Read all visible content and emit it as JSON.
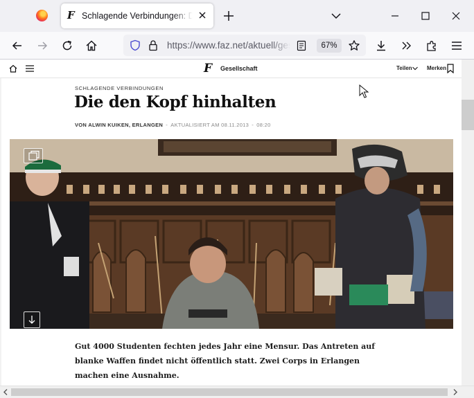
{
  "browser": {
    "tab_title": "Schlagende Verbindungen: Die den Kopf hinhalten",
    "url": "https://www.faz.net/aktuell/gesellschaft/",
    "zoom": "67%"
  },
  "site": {
    "logo": "F",
    "section": "Gesellschaft",
    "share_label": "Teilen",
    "save_label": "Merken"
  },
  "article": {
    "kicker": "SCHLAGENDE VERBINDUNGEN",
    "headline": "Die den Kopf hinhalten",
    "byline": {
      "author": "VON ALWIN KUIKEN, ERLANGEN",
      "separator": "-",
      "updated": "AKTUALISIERT AM 08.11.2013",
      "separator2": "-",
      "time": "08:20"
    },
    "teaser": "Gut 4000 Studenten fechten jedes Jahr eine Mensur. Das Antreten auf blanke Waffen findet nicht öffentlich statt. Zwei Corps in Erlangen machen eine Ausnahme."
  },
  "colors": {
    "chrome_bg": "#f0f0f4",
    "toolbar_bg": "#f9f9fb",
    "text": "#1d1d1d",
    "meta_gray": "#888888"
  }
}
